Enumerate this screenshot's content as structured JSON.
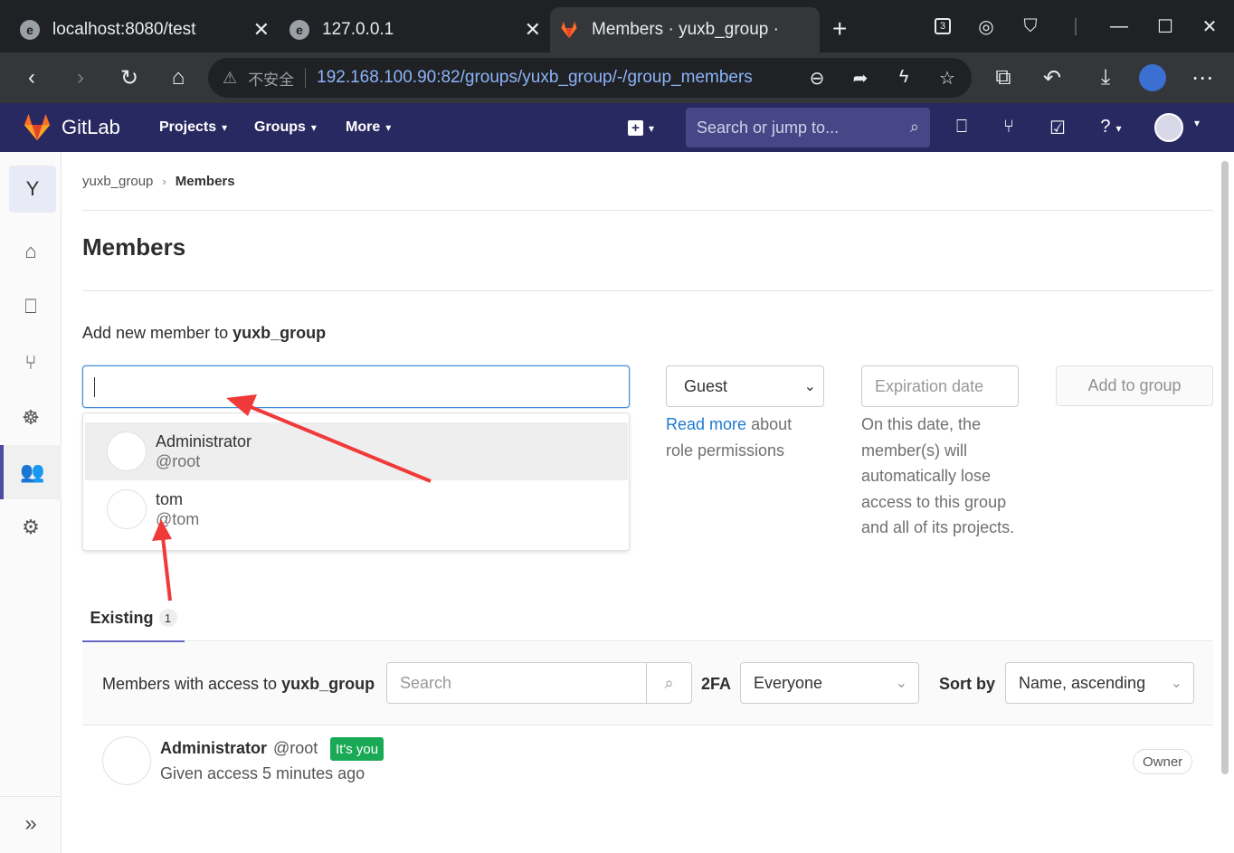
{
  "browser": {
    "tabs": [
      {
        "title": "localhost:8080/test"
      },
      {
        "title": "127.0.0.1"
      },
      {
        "title": "Members · yuxb_group ·"
      }
    ],
    "tab_count_badge": "3",
    "address": {
      "insecure_label": "不安全",
      "url": "192.168.100.90:82/groups/yuxb_group/-/group_members"
    }
  },
  "gitlab_header": {
    "brand": "GitLab",
    "nav": [
      {
        "label": "Projects"
      },
      {
        "label": "Groups"
      },
      {
        "label": "More"
      }
    ],
    "search_placeholder": "Search or jump to..."
  },
  "sidebar": {
    "group_initial": "Y",
    "items": [
      {
        "icon": "home-icon"
      },
      {
        "icon": "issues-icon"
      },
      {
        "icon": "merge-request-icon"
      },
      {
        "icon": "kubernetes-icon"
      },
      {
        "icon": "members-icon",
        "active": true
      },
      {
        "icon": "settings-icon"
      }
    ]
  },
  "breadcrumb": {
    "group": "yuxb_group",
    "current": "Members"
  },
  "page_title": "Members",
  "add_member": {
    "label_prefix": "Add new member to",
    "group_name": "yuxb_group",
    "suggestions": [
      {
        "name": "Administrator",
        "username": "@root",
        "highlighted": true
      },
      {
        "name": "tom",
        "username": "@tom",
        "highlighted": false
      }
    ],
    "role": "Guest",
    "role_help_link": "Read more",
    "role_help_text": "about role permissions",
    "expiration_placeholder": "Expiration date",
    "expiration_help": "On this date, the member(s) will automatically lose access to this group and all of its projects.",
    "add_button": "Add to group"
  },
  "tabs": {
    "existing_label": "Existing",
    "existing_count": "1"
  },
  "filter": {
    "label_prefix": "Members with access to",
    "group_name": "yuxb_group",
    "search_placeholder": "Search",
    "twofa_label": "2FA",
    "twofa_value": "Everyone",
    "sort_label": "Sort by",
    "sort_value": "Name, ascending"
  },
  "members": [
    {
      "name": "Administrator",
      "username": "@root",
      "badge": "It's you",
      "access": "Given access 5 minutes ago",
      "role": "Owner"
    }
  ],
  "colors": {
    "gitlab_header": "#292961",
    "link": "#1f78d1",
    "badge_green": "#1aaa55",
    "annotation_arrow": "#f03a3a"
  }
}
